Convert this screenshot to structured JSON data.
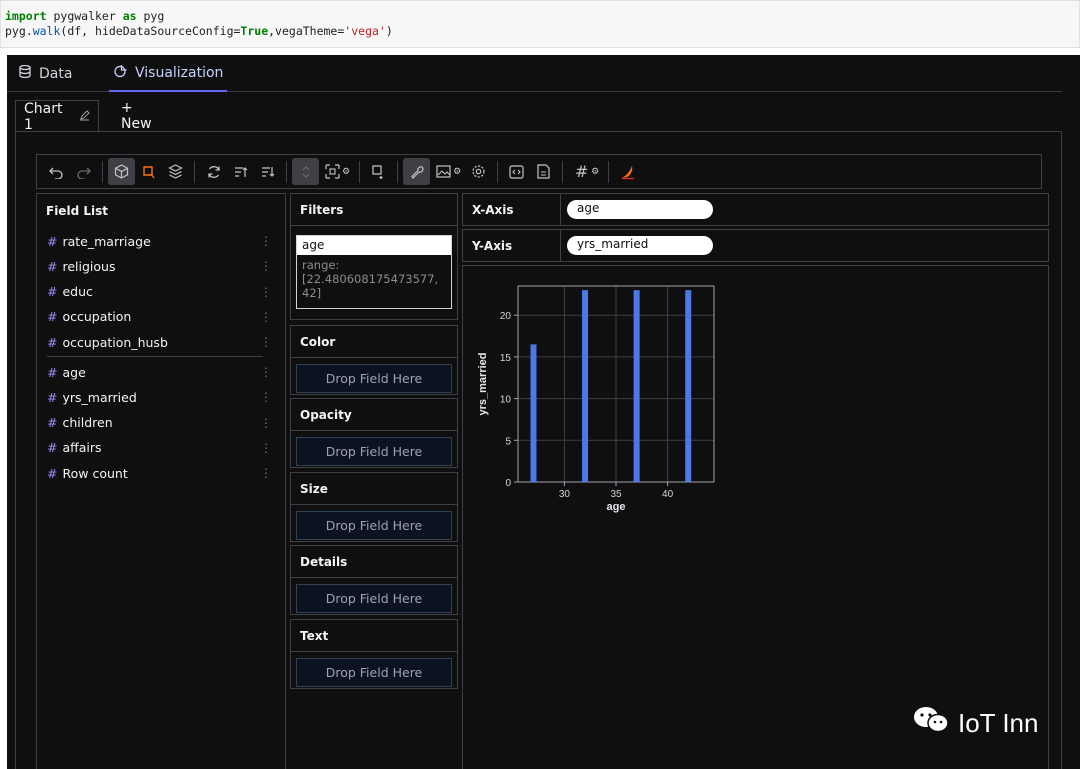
{
  "code": {
    "line1": {
      "kw1": "import",
      "mod": " pygwalker ",
      "kw2": "as",
      "alias": " pyg"
    },
    "line2": {
      "pre": "pyg.",
      "fn": "walk",
      "args": "(df, hideDataSourceConfig=",
      "true": "True",
      "mid": ",vegaTheme=",
      "str": "'vega'",
      "end": ")"
    }
  },
  "tabs": {
    "data": "Data",
    "visualization": "Visualization"
  },
  "chart_tabs": {
    "chart1": "Chart 1",
    "new": "+ New"
  },
  "field_list": {
    "title": "Field List",
    "dimensions": [
      "rate_marriage",
      "religious",
      "educ",
      "occupation",
      "occupation_husb"
    ],
    "measures": [
      "age",
      "yrs_married",
      "children",
      "affairs",
      "Row count"
    ]
  },
  "filters": {
    "title": "Filters",
    "field": "age",
    "range_label": "range:",
    "range_value": "[22.480608175473577, 42]"
  },
  "encodings": {
    "color": "Color",
    "opacity": "Opacity",
    "size": "Size",
    "details": "Details",
    "text": "Text",
    "drop_label": "Drop Field Here"
  },
  "axes": {
    "x_label": "X-Axis",
    "x_field": "age",
    "y_label": "Y-Axis",
    "y_field": "yrs_married"
  },
  "chart_data": {
    "type": "bar",
    "x": [
      27,
      32,
      37,
      42
    ],
    "values": [
      16.5,
      23,
      23,
      23
    ],
    "xlabel": "age",
    "ylabel": "yrs_married",
    "xticks": [
      30,
      35,
      40
    ],
    "yticks": [
      0,
      5,
      10,
      15,
      20
    ],
    "xlim": [
      25.5,
      44.5
    ],
    "ylim": [
      0,
      23.5
    ],
    "grid": true,
    "bar_color": "#4c78e8"
  },
  "brand": "IoT Inn"
}
